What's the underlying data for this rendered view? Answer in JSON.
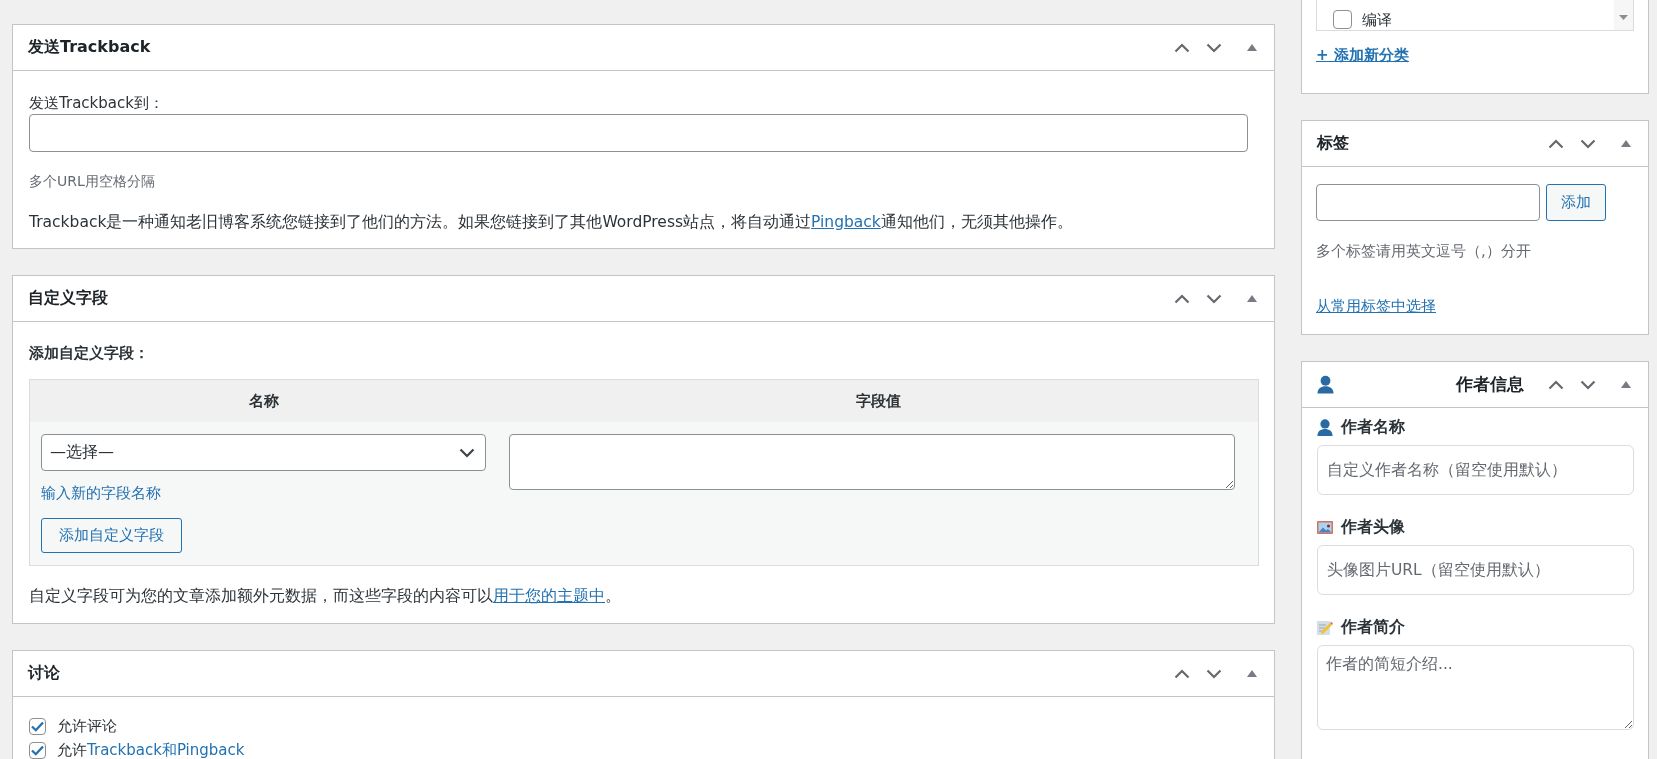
{
  "trackback_panel": {
    "title": "发送Trackback",
    "field_label": "发送Trackback到：",
    "hint": "多个URL用空格分隔",
    "description": {
      "text_before": "Trackback是一种通知老旧博客系统您链接到了他们的方法。如果您链接到了其他WordPress站点，将自动通过",
      "link": "Pingback",
      "text_after": "通知他们，无须其他操作。"
    }
  },
  "custom_fields_panel": {
    "title": "自定义字段",
    "subtitle": "添加自定义字段：",
    "columns": [
      "名称",
      "字段值"
    ],
    "name_select": {
      "value": "—选择—"
    },
    "new_field_link": "输入新的字段名称",
    "add_button": "添加自定义字段",
    "note": {
      "text_before": "自定义字段可为您的文章添加额外元数据，而这些字段的内容可以",
      "link": "用于您的主题中",
      "text_after": "。"
    }
  },
  "discussion_panel": {
    "title": "讨论",
    "options": [
      {
        "label": "允许评论",
        "checked": true
      },
      {
        "label": "允许",
        "link": "Trackback和Pingback",
        "checked": true
      }
    ]
  },
  "categories_panel": {
    "categories": [
      {
        "label": "编译",
        "checked": false
      }
    ],
    "add_link": "+ 添加新分类"
  },
  "tags_panel": {
    "title": "标签",
    "add_button": "添加",
    "hint": "多个标签请用英文逗号（,）分开",
    "choose_link": "从常用标签中选择"
  },
  "author_panel": {
    "title": "作者信息",
    "fields": [
      {
        "kind": "name",
        "label": "作者名称",
        "placeholder": "自定义作者名称（留空使用默认）"
      },
      {
        "kind": "avatar",
        "label": "作者头像",
        "placeholder": "头像图片URL（留空使用默认）"
      },
      {
        "kind": "bio",
        "label": "作者简介",
        "placeholder": "作者的简短介绍..."
      }
    ]
  }
}
